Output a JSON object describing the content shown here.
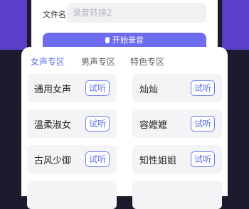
{
  "dialog": {
    "filename_label": "文件名",
    "filename_placeholder": "录音转换2",
    "start_label": "开始录音"
  },
  "tabs": [
    {
      "label": "女声专区",
      "active": true
    },
    {
      "label": "男声专区",
      "active": false
    },
    {
      "label": "特色专区",
      "active": false
    }
  ],
  "voices": [
    {
      "name": "通用女声",
      "try": "试听"
    },
    {
      "name": "灿灿",
      "try": "试听"
    },
    {
      "name": "温柔淑女",
      "try": "试听"
    },
    {
      "name": "容嬷嬷",
      "try": "试听"
    },
    {
      "name": "古风少御",
      "try": "试听"
    },
    {
      "name": "知性姐姐",
      "try": "试听"
    }
  ],
  "colors": {
    "accent": "#5b6de6",
    "button": "#6d6bf0",
    "frame": "#5a3fc8"
  }
}
